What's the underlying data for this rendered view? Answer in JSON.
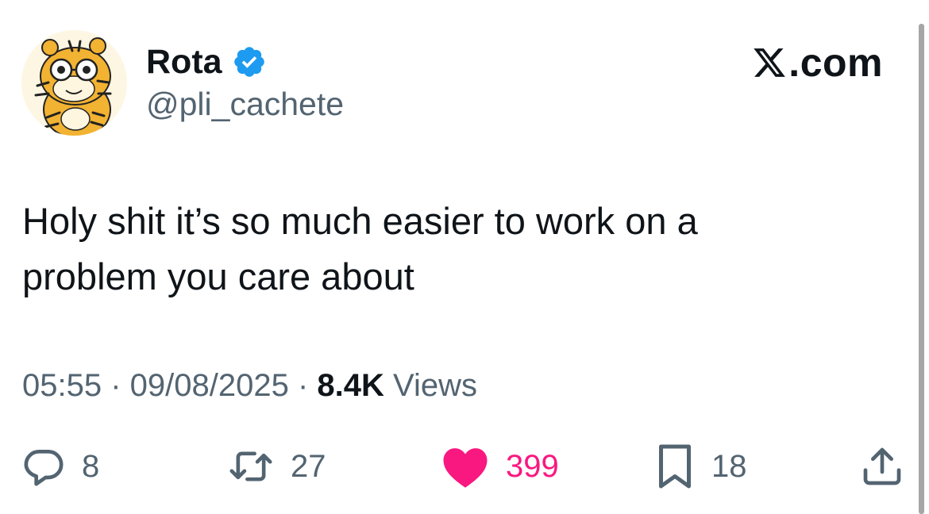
{
  "author": {
    "display_name": "Rota",
    "handle": "@pli_cachete",
    "verified": true,
    "avatar": "tiger-cartoon-avatar"
  },
  "brand": {
    "logo": "x-logo-icon",
    "text": ".com"
  },
  "tweet": {
    "text": "Holy shit it’s so much easier to work on a problem you care about"
  },
  "meta": {
    "time": "05:55",
    "separator": " · ",
    "date": "09/08/2025",
    "views_count": "8.4K",
    "views_label": " Views"
  },
  "actions": {
    "replies": "8",
    "retweets": "27",
    "likes": "399",
    "bookmarks": "18"
  },
  "colors": {
    "text": "#0f1419",
    "secondary": "#536471",
    "like": "#f91880",
    "verified": "#1d9bf0"
  }
}
